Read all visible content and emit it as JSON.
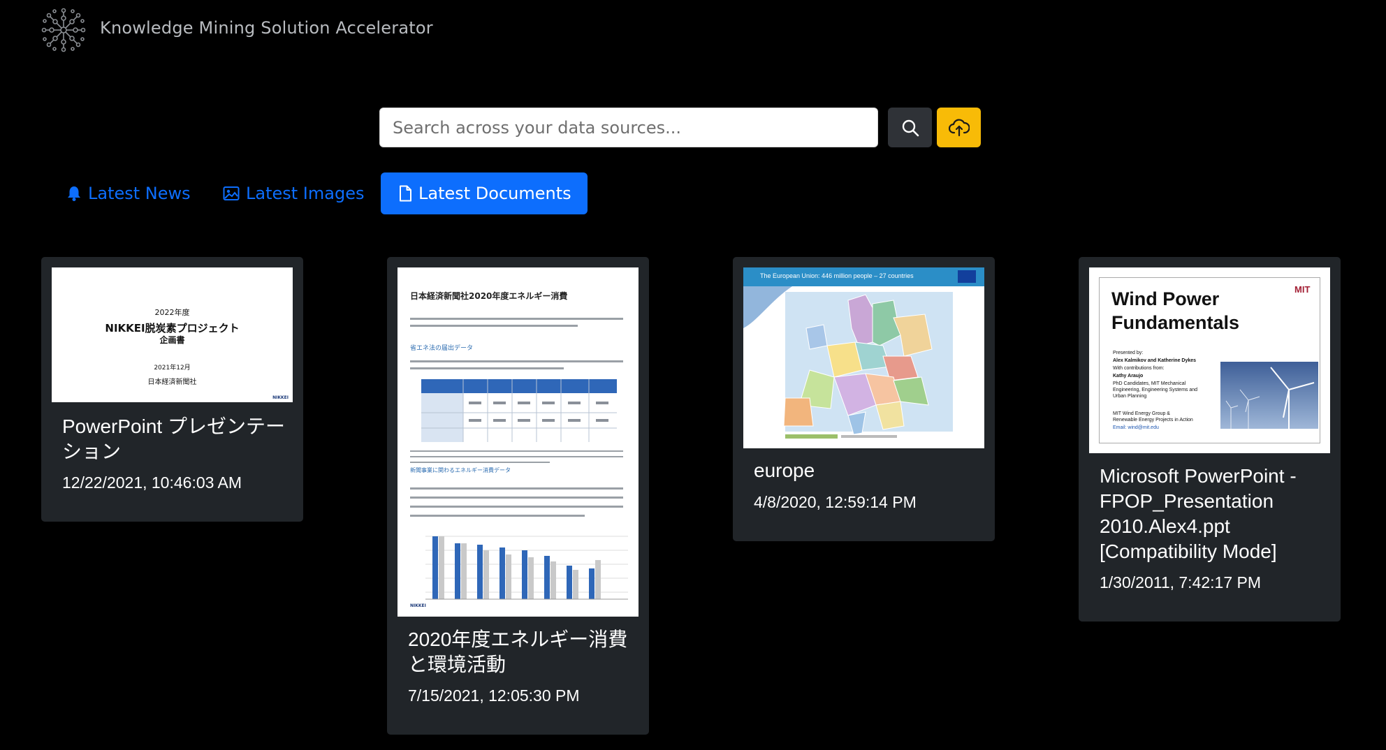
{
  "app": {
    "title": "Knowledge Mining Solution Accelerator",
    "logo_icon": "network-nodes-icon"
  },
  "search": {
    "placeholder": "Search across your data sources...",
    "value": "",
    "search_icon": "search-icon",
    "upload_icon": "cloud-upload-icon"
  },
  "tabs": [
    {
      "label": "Latest News",
      "icon": "bell-icon",
      "active": false
    },
    {
      "label": "Latest Images",
      "icon": "image-icon",
      "active": false
    },
    {
      "label": "Latest Documents",
      "icon": "document-icon",
      "active": true
    }
  ],
  "documents": [
    {
      "title": "PowerPoint プレゼンテーション",
      "date": "12/22/2021, 10:46:03 AM",
      "thumbnail": {
        "lines": [
          "2022年度",
          "NIKKEI脱炭素プロジェクト",
          "企画書",
          "2021年12月",
          "日本経済新聞社"
        ],
        "logo": "NIKKEI"
      }
    },
    {
      "title": "2020年度エネルギー消費と環境活動",
      "date": "7/15/2021, 12:05:30 PM",
      "thumbnail": {
        "heading": "日本経済新聞社2020年度エネルギー消費",
        "sub1": "省エネ法の届出データ",
        "sub2": "新聞事業に関わるエネルギー消費データ",
        "logo": "NIKKEI"
      }
    },
    {
      "title": "europe",
      "date": "4/8/2020, 12:59:14 PM",
      "thumbnail": {
        "banner": "The European Union: 446 million people – 27 countries"
      }
    },
    {
      "title": "Microsoft PowerPoint - FPOP_Presentation 2010.Alex4.ppt [Compatibility Mode]",
      "date": "1/30/2011, 7:42:17 PM",
      "thumbnail": {
        "heading": "Wind Power Fundamentals",
        "brand": "MIT",
        "presented_by": "Presented by:",
        "authors": "Alex Kalmikov and Katherine Dykes",
        "contrib": "With contributions from:",
        "contrib_name": "Kathy Araujo",
        "affil1": "PhD Candidates, MIT Mechanical",
        "affil2": "Engineering, Engineering Systems and",
        "affil3": "Urban Planning",
        "group1": "MIT Wind Energy Group &",
        "group2": "Renewable Energy Projects in Action",
        "email": "Email: wind@mit.edu"
      }
    }
  ],
  "colors": {
    "background": "#000000",
    "card": "#212529",
    "accent": "#0d6efd",
    "upload": "#f8bb07",
    "search_button": "#2f3237"
  }
}
